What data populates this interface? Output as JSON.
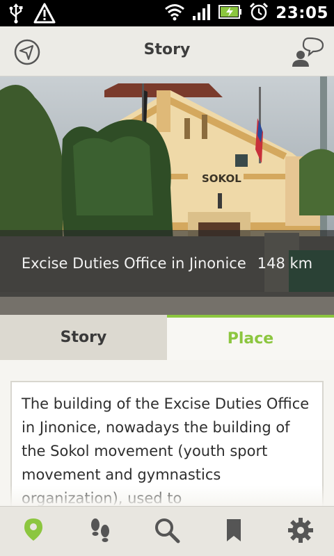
{
  "status_bar": {
    "time": "23:05",
    "icons": [
      "usb-icon",
      "warning-icon",
      "wifi-icon",
      "signal-icon",
      "battery-charging-icon",
      "alarm-icon"
    ]
  },
  "action_bar": {
    "title": "Story",
    "left_icon": "navigation-arrow-icon",
    "right_icon": "profile-chat-icon"
  },
  "hero": {
    "building_sign": "SOKOL",
    "caption_title": "Excise Duties Office in Jinonice",
    "caption_distance": "148 km"
  },
  "tabs": [
    {
      "label": "Story",
      "selected": false
    },
    {
      "label": "Place",
      "selected": true
    }
  ],
  "content": {
    "text": "The building of the Excise Duties Office in Jinonice, nowadays the building of the Sokol movement (youth sport movement and gymnastics organization), used to"
  },
  "bottom_nav": [
    {
      "icon": "location-pin-icon",
      "active": true
    },
    {
      "icon": "footsteps-icon",
      "active": false
    },
    {
      "icon": "search-icon",
      "active": false
    },
    {
      "icon": "bookmark-icon",
      "active": false
    },
    {
      "icon": "settings-gear-icon",
      "active": false
    }
  ],
  "colors": {
    "accent": "#8cc63f",
    "status_bar": "#000000",
    "action_bar": "#ecebe6",
    "icon_gray": "#555555"
  }
}
